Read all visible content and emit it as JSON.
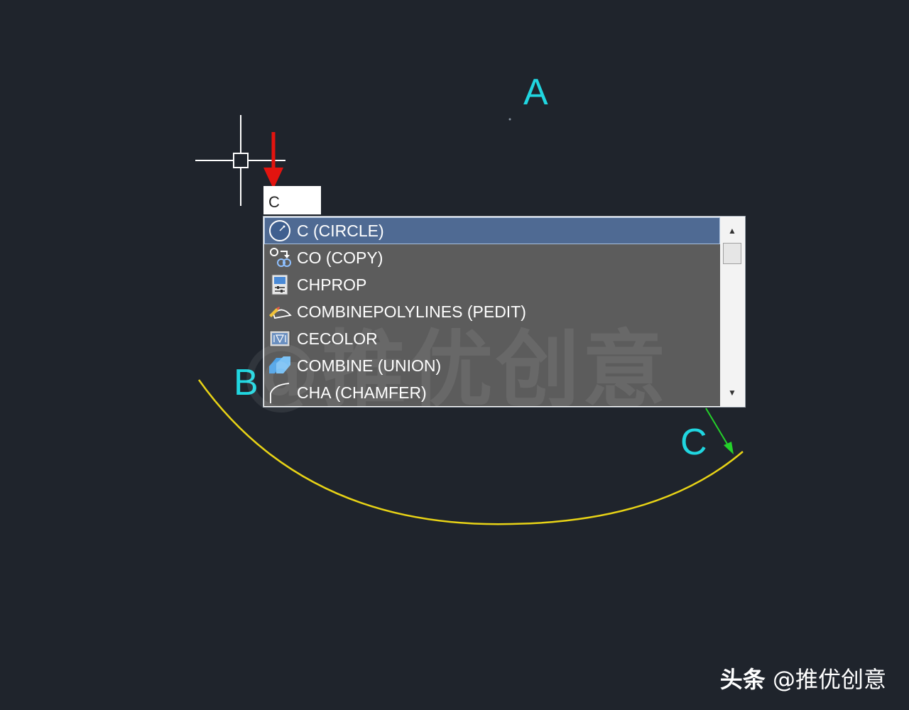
{
  "canvas": {
    "background": "#1f242c",
    "labels": {
      "a": "A",
      "b": "B",
      "c": "C"
    },
    "label_color": "#20d6e0",
    "arc_color": "#e8d316",
    "arrow_red": "#e3140f",
    "arrow_green": "#24d12a",
    "crosshair_color": "#ffffff"
  },
  "command_input": {
    "value": "C"
  },
  "autocomplete": {
    "items": [
      {
        "label": "C (CIRCLE)",
        "icon": "circle-icon",
        "selected": true
      },
      {
        "label": "CO (COPY)",
        "icon": "copy-icon",
        "selected": false
      },
      {
        "label": "CHPROP",
        "icon": "properties-icon",
        "selected": false
      },
      {
        "label": "COMBINEPOLYLINES (PEDIT)",
        "icon": "pedit-icon",
        "selected": false
      },
      {
        "label": "CECOLOR",
        "icon": "color-icon",
        "selected": false
      },
      {
        "label": "COMBINE (UNION)",
        "icon": "union-icon",
        "selected": false
      },
      {
        "label": "CHA (CHAMFER)",
        "icon": "chamfer-icon",
        "selected": false
      }
    ],
    "list_bg": "#5c5c5c",
    "selected_bg": "#4f6a93"
  },
  "watermark": {
    "at": "@",
    "text": "推优创意"
  },
  "credit": {
    "brand": "头条",
    "handle": "@推优创意"
  }
}
